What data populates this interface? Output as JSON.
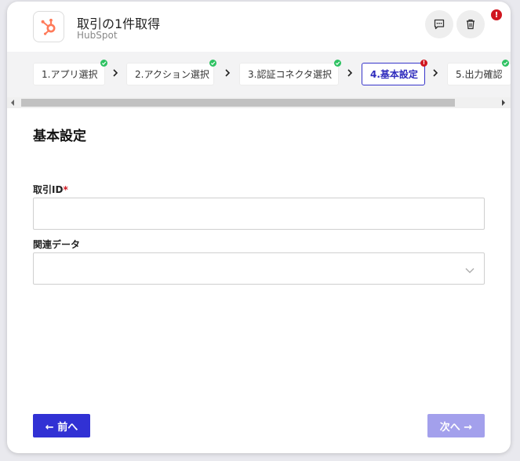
{
  "header": {
    "title": "取引の1件取得",
    "subtitle": "HubSpot",
    "alert_count": "!"
  },
  "steps": [
    {
      "label": "1.アプリ選択",
      "status": "complete"
    },
    {
      "label": "2.アクション選択",
      "status": "complete"
    },
    {
      "label": "3.認証コネクタ選択",
      "status": "complete"
    },
    {
      "label": "4.基本設定",
      "status": "error",
      "badge": "!"
    },
    {
      "label": "5.出力確認",
      "status": "complete"
    }
  ],
  "section": {
    "title": "基本設定"
  },
  "fields": {
    "deal_id": {
      "label": "取引ID",
      "required_mark": "*",
      "value": "",
      "placeholder": ""
    },
    "related_data": {
      "label": "関連データ",
      "value": ""
    }
  },
  "footer": {
    "prev_label": "← 前へ",
    "next_label": "次へ →"
  },
  "colors": {
    "primary": "#3131d4",
    "primary_disabled": "#a3a0ec",
    "success": "#2ec262",
    "error": "#d0161f",
    "hubspot_orange": "#ff7a59"
  },
  "icons": {
    "app_logo": "hubspot-logo-icon",
    "comment": "comment-icon",
    "delete": "trash-icon",
    "step_chevron": "chevron-right-icon",
    "select_chevron": "chevron-down-icon"
  }
}
